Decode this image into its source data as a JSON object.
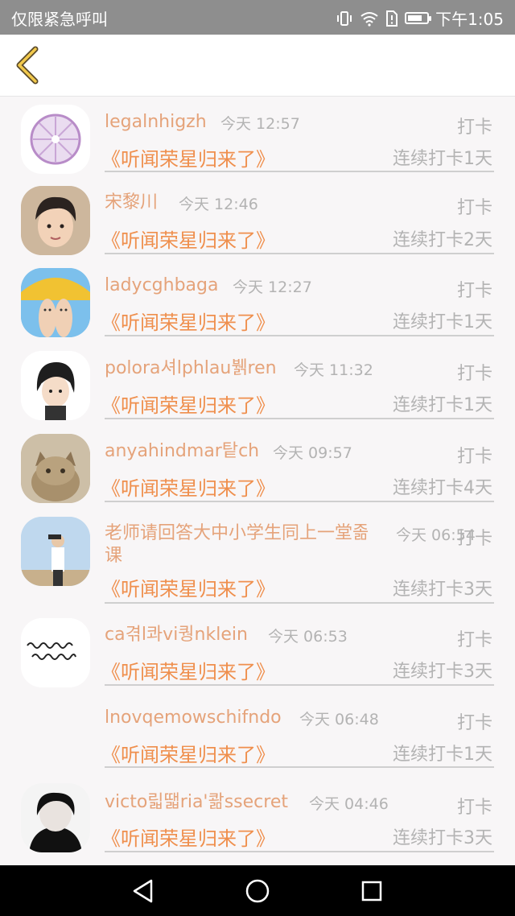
{
  "status_bar": {
    "carrier": "仅限紧急呼叫",
    "time": "下午1:05",
    "battery_level": 0.75,
    "icons": [
      "vibrate-icon",
      "wifi-icon",
      "sim-alert-icon",
      "battery-icon"
    ]
  },
  "header": {
    "back_icon": "chevron-left-icon"
  },
  "list": {
    "items": [
      {
        "name": "legalnhigzh",
        "time": "今天 12:57",
        "tag": "打卡",
        "book": "《听闻荣星归来了》",
        "streak": "连续打卡1天"
      },
      {
        "name": "宋黎川",
        "time": "今天 12:46",
        "tag": "打卡",
        "book": "《听闻荣星归来了》",
        "streak": "连续打卡2天"
      },
      {
        "name": "ladycghbaga",
        "time": "今天 12:27",
        "tag": "打卡",
        "book": "《听闻荣星归来了》",
        "streak": "连续打卡1天"
      },
      {
        "name": "polora셔lphlau뷁ren",
        "time": "今天 11:32",
        "tag": "打卡",
        "book": "《听闻荣星归来了》",
        "streak": "连续打卡1天"
      },
      {
        "name": "anyahindmar탙ch",
        "time": "今天 09:57",
        "tag": "打卡",
        "book": "《听闻荣星归来了》",
        "streak": "连续打卡4天"
      },
      {
        "name": "老师请回答大中小学生同上一堂졺课",
        "time": "今天 06:54",
        "tag": "打卡",
        "book": "《听闻荣星归来了》",
        "streak": "连续打卡3天"
      },
      {
        "name": "ca겪l콰vi퀑nklein",
        "time": "今天 06:53",
        "tag": "打卡",
        "book": "《听闻荣星归来了》",
        "streak": "连续打卡3天"
      },
      {
        "name": "lnovqemowschifndo",
        "time": "今天 06:48",
        "tag": "打卡",
        "book": "《听闻荣星归来了》",
        "streak": "连续打卡1天"
      },
      {
        "name": "victo릷땗ria'콺ssecret",
        "time": "今天 04:46",
        "tag": "打卡",
        "book": "《听闻荣星归来了》",
        "streak": "连续打卡3天"
      }
    ]
  },
  "nav_bar": {
    "icons": [
      "back-triangle-icon",
      "home-circle-icon",
      "recents-square-icon"
    ]
  },
  "colors": {
    "accent": "#ef8f4d",
    "name": "#e5a37a",
    "muted": "#b3b3b3"
  }
}
